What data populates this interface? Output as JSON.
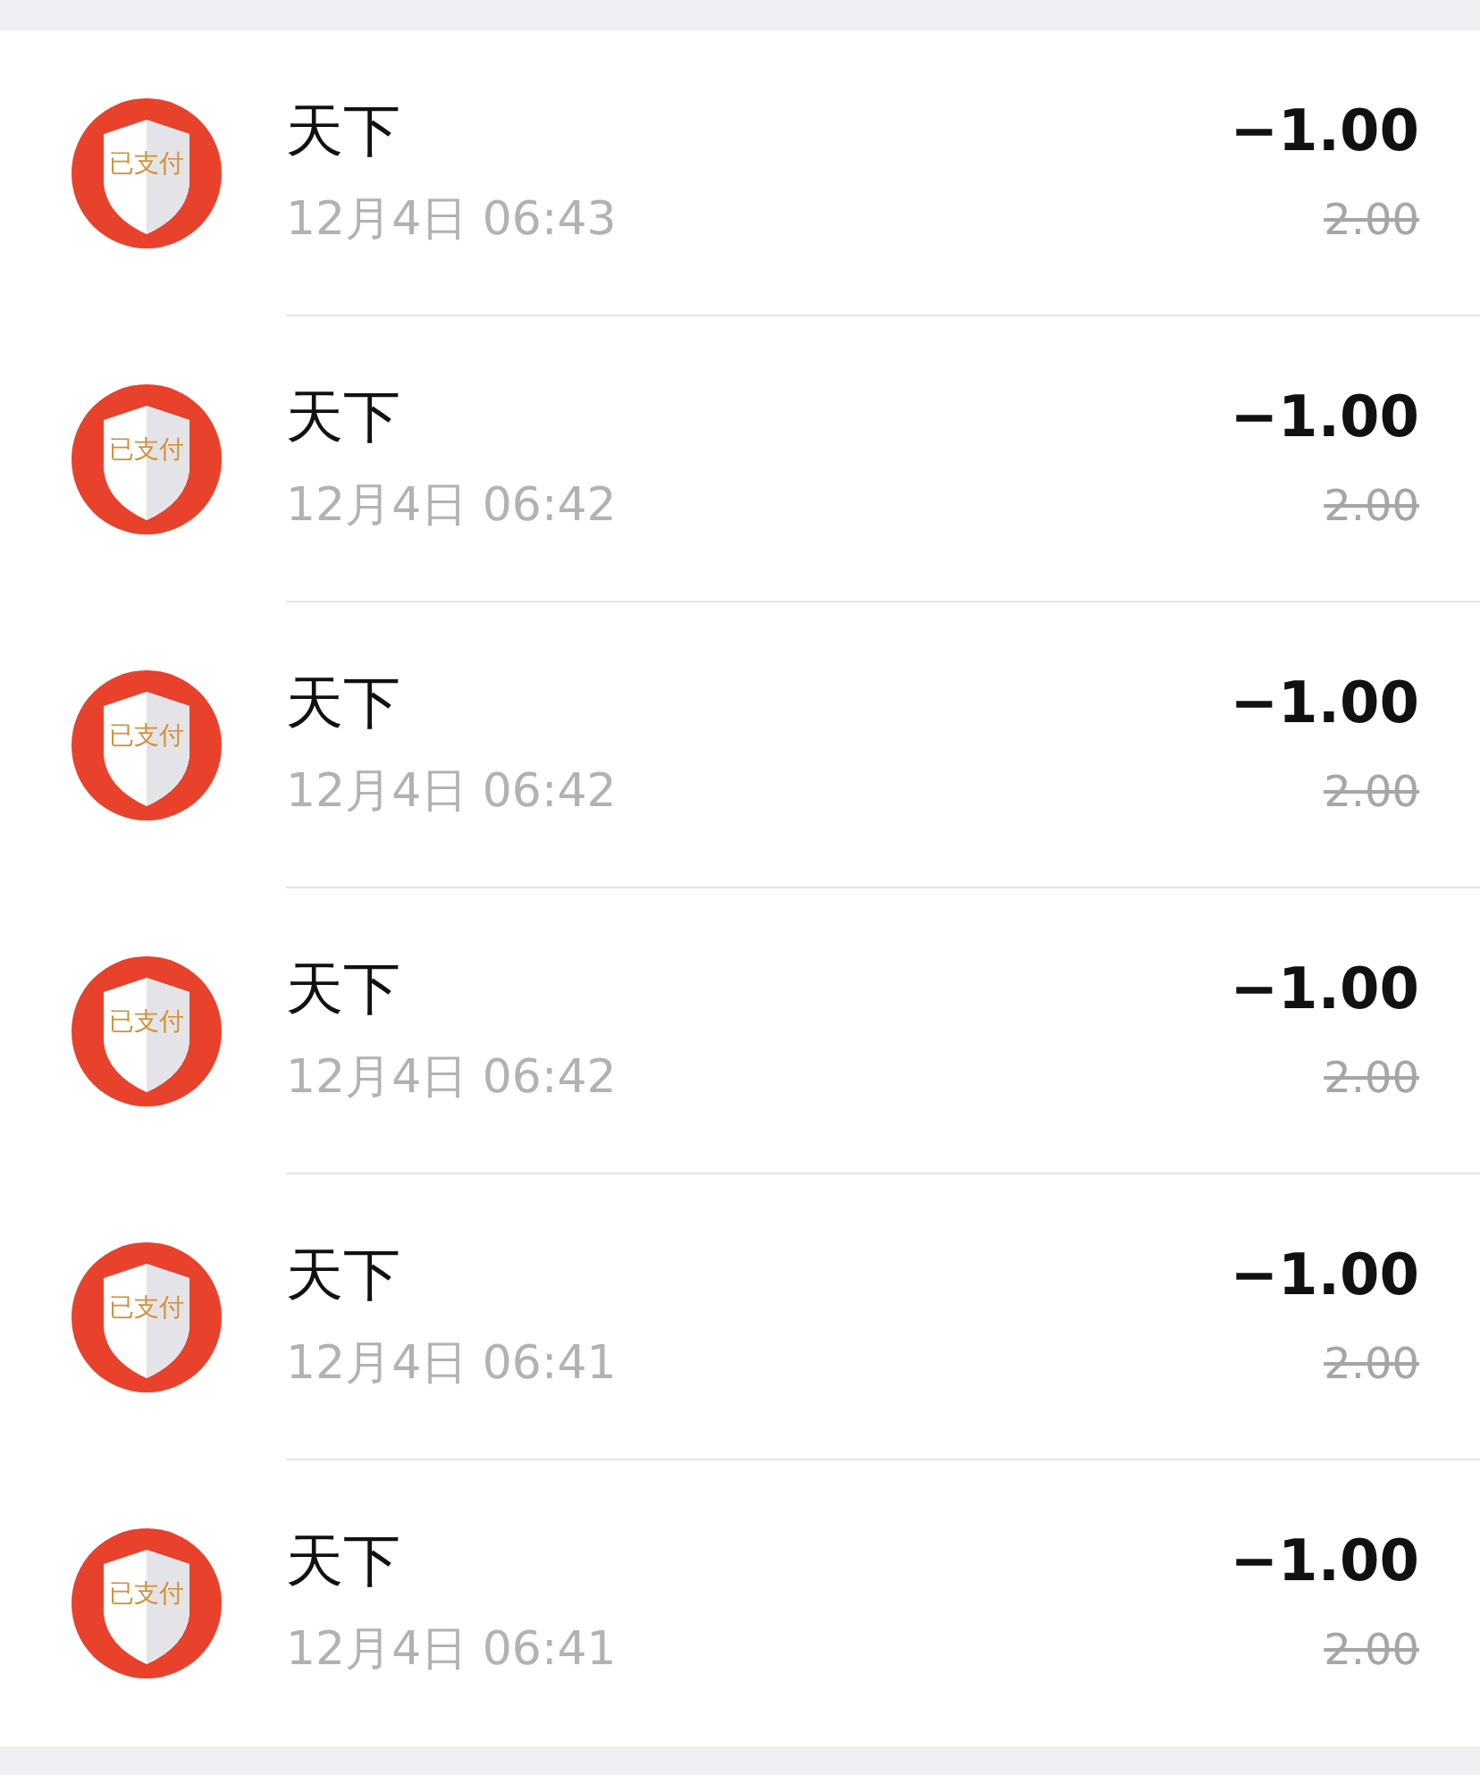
{
  "transactions": [
    {
      "badge": "已支付",
      "name": "天下",
      "time": "12月4日 06:43",
      "amount": "−1.00",
      "original": "2.00"
    },
    {
      "badge": "已支付",
      "name": "天下",
      "time": "12月4日 06:42",
      "amount": "−1.00",
      "original": "2.00"
    },
    {
      "badge": "已支付",
      "name": "天下",
      "time": "12月4日 06:42",
      "amount": "−1.00",
      "original": "2.00"
    },
    {
      "badge": "已支付",
      "name": "天下",
      "time": "12月4日 06:42",
      "amount": "−1.00",
      "original": "2.00"
    },
    {
      "badge": "已支付",
      "name": "天下",
      "time": "12月4日 06:41",
      "amount": "−1.00",
      "original": "2.00"
    },
    {
      "badge": "已支付",
      "name": "天下",
      "time": "12月4日 06:41",
      "amount": "−1.00",
      "original": "2.00"
    }
  ]
}
